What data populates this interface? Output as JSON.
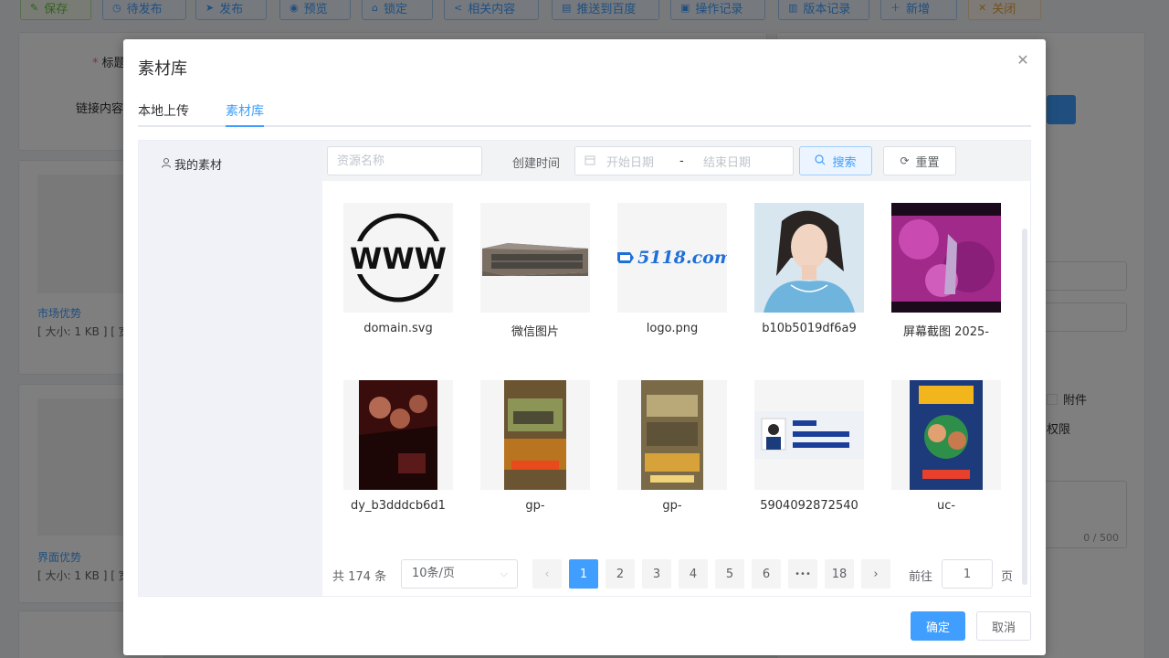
{
  "toolbar": {
    "buttons": [
      {
        "label": "保存",
        "icon": "edit-icon",
        "color": "green"
      },
      {
        "label": "待发布",
        "icon": "clock-icon",
        "color": "blue"
      },
      {
        "label": "发布",
        "icon": "send-icon",
        "color": "blue"
      },
      {
        "label": "预览",
        "icon": "eye-icon",
        "color": "blue"
      },
      {
        "label": "锁定",
        "icon": "lock-icon",
        "color": "blue"
      },
      {
        "label": "相关内容",
        "icon": "share-icon",
        "color": "blue"
      },
      {
        "label": "推送到百度",
        "icon": "push-icon",
        "color": "blue"
      },
      {
        "label": "操作记录",
        "icon": "record-icon",
        "color": "blue"
      },
      {
        "label": "版本记录",
        "icon": "version-icon",
        "color": "blue"
      },
      {
        "label": "新增",
        "icon": "plus-icon",
        "color": "blue"
      },
      {
        "label": "关闭",
        "icon": "close-icon",
        "color": "orange"
      }
    ]
  },
  "background": {
    "title_label": "标题",
    "link_label": "链接内容",
    "item1_name": "市场优势",
    "item1_meta": "[ 大小: 1 KB ] [ 宽",
    "item2_name": "界面优势",
    "item2_meta": "[ 大小: 1 KB ] [ 宽",
    "attachment_label": "附件",
    "permission_label": "权限",
    "counter": "0 / 500"
  },
  "dialog": {
    "title": "素材库",
    "tabs": [
      {
        "label": "本地上传",
        "active": false
      },
      {
        "label": "素材库",
        "active": true
      }
    ],
    "sidebar": {
      "my_materials": "我的素材"
    },
    "filter": {
      "name_placeholder": "资源名称",
      "created_label": "创建时间",
      "start_placeholder": "开始日期",
      "separator": "-",
      "end_placeholder": "结束日期",
      "search_label": "搜索",
      "reset_label": "重置"
    },
    "items": [
      {
        "name": "domain.svg",
        "kind": "www-logo"
      },
      {
        "name": "微信图片",
        "kind": "building-photo"
      },
      {
        "name": "logo.png",
        "kind": "brand-logo",
        "logo_text": "5118.com"
      },
      {
        "name": "b10b5019df6a9",
        "kind": "portrait-photo"
      },
      {
        "name": "屏幕截图 2025-",
        "kind": "game-screenshot"
      },
      {
        "name": "dy_b3dddcb6d1",
        "kind": "movie-poster"
      },
      {
        "name": "gp-",
        "kind": "game-poster"
      },
      {
        "name": "gp-",
        "kind": "game-poster"
      },
      {
        "name": "5904092872540",
        "kind": "id-banner"
      },
      {
        "name": "uc-",
        "kind": "game-poster"
      }
    ],
    "pagination": {
      "total": "共 174 条",
      "page_size": "10条/页",
      "pages": [
        "1",
        "2",
        "3",
        "4",
        "5",
        "6",
        "•••",
        "18"
      ],
      "current": "1",
      "goto_label": "前往",
      "goto_value": "1",
      "page_suffix": "页"
    },
    "confirm_label": "确定",
    "cancel_label": "取消"
  },
  "colors": {
    "primary": "#409eff",
    "success": "#67c23a",
    "warning": "#e6a23c",
    "overlay": "rgba(0,0,0,0.5)"
  }
}
